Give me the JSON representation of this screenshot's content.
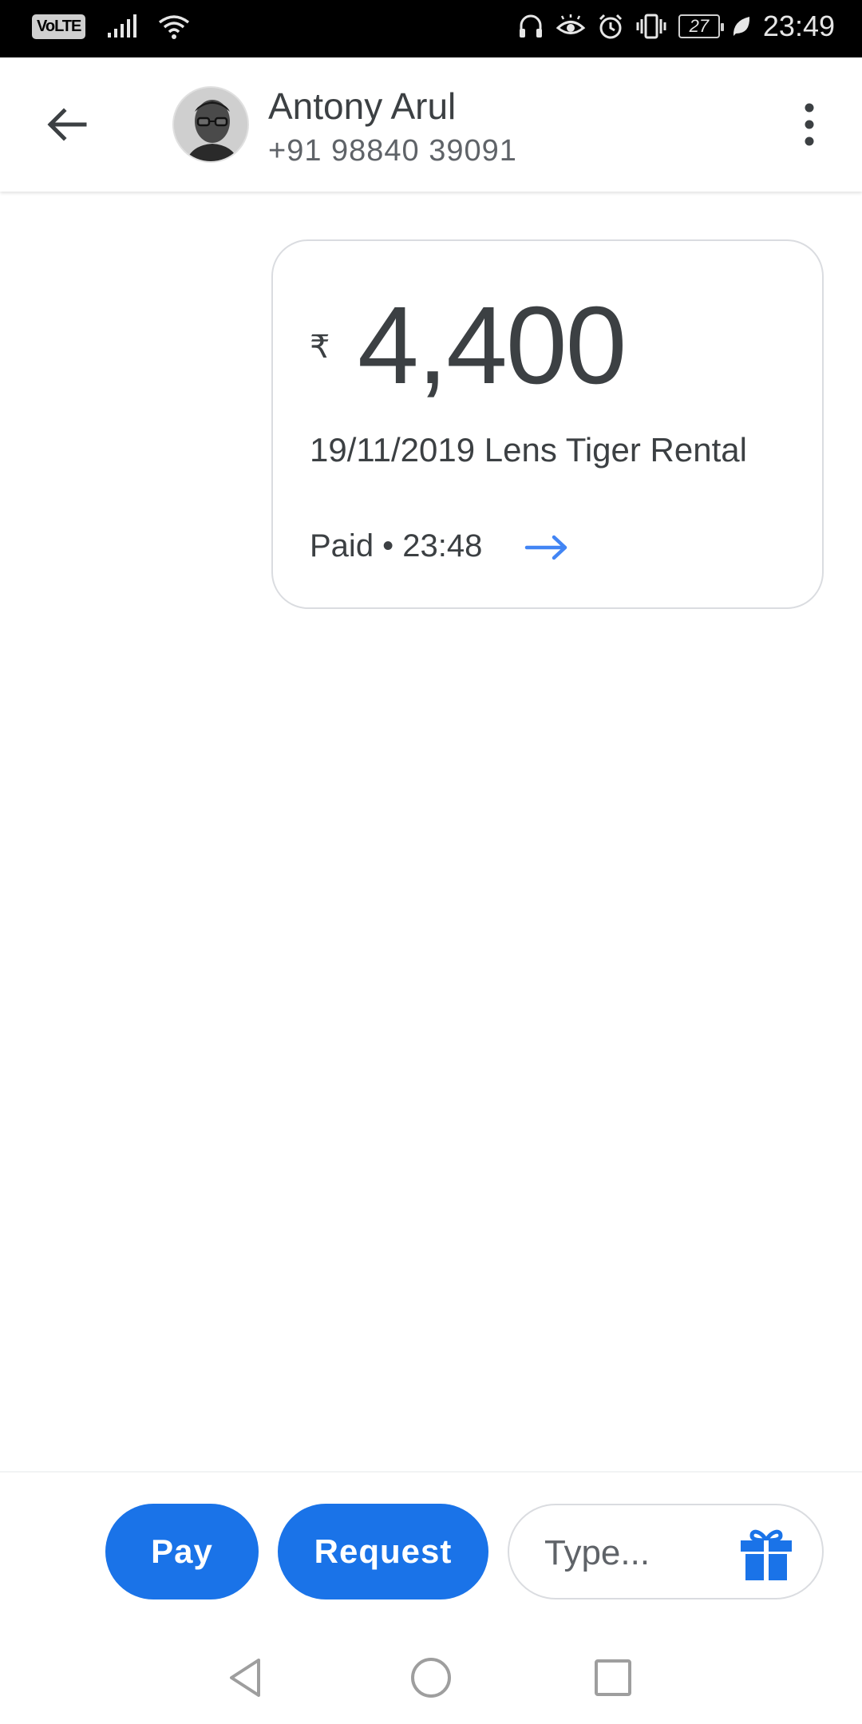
{
  "status_bar": {
    "network_badge": "VoLTE",
    "battery_level": "27",
    "time": "23:49",
    "icons": [
      "signal-icon",
      "wifi-icon",
      "headphones-icon",
      "eye-comfort-icon",
      "alarm-icon",
      "vibrate-icon",
      "battery-icon",
      "leaf-icon"
    ]
  },
  "header": {
    "contact_name": "Antony Arul",
    "contact_phone": "+91 98840 39091",
    "back_icon": "arrow-left-icon",
    "menu_icon": "more-vert-icon"
  },
  "payment": {
    "currency_symbol": "₹",
    "amount": "4,400",
    "note": "19/11/2019 Lens Tiger Rental",
    "status_text": "Paid • 23:48",
    "details_icon": "arrow-right-icon"
  },
  "bottom_bar": {
    "pay_label": "Pay",
    "request_label": "Request",
    "message_placeholder": "Type...",
    "gift_icon": "gift-icon"
  },
  "nav_bar": {
    "icons": [
      "nav-back-icon",
      "nav-home-icon",
      "nav-recents-icon"
    ]
  },
  "colors": {
    "accent": "#1a73e8",
    "text_primary": "#3c4043",
    "text_secondary": "#5f6368",
    "card_border": "#dadce0",
    "status_bar_bg": "#000000"
  }
}
